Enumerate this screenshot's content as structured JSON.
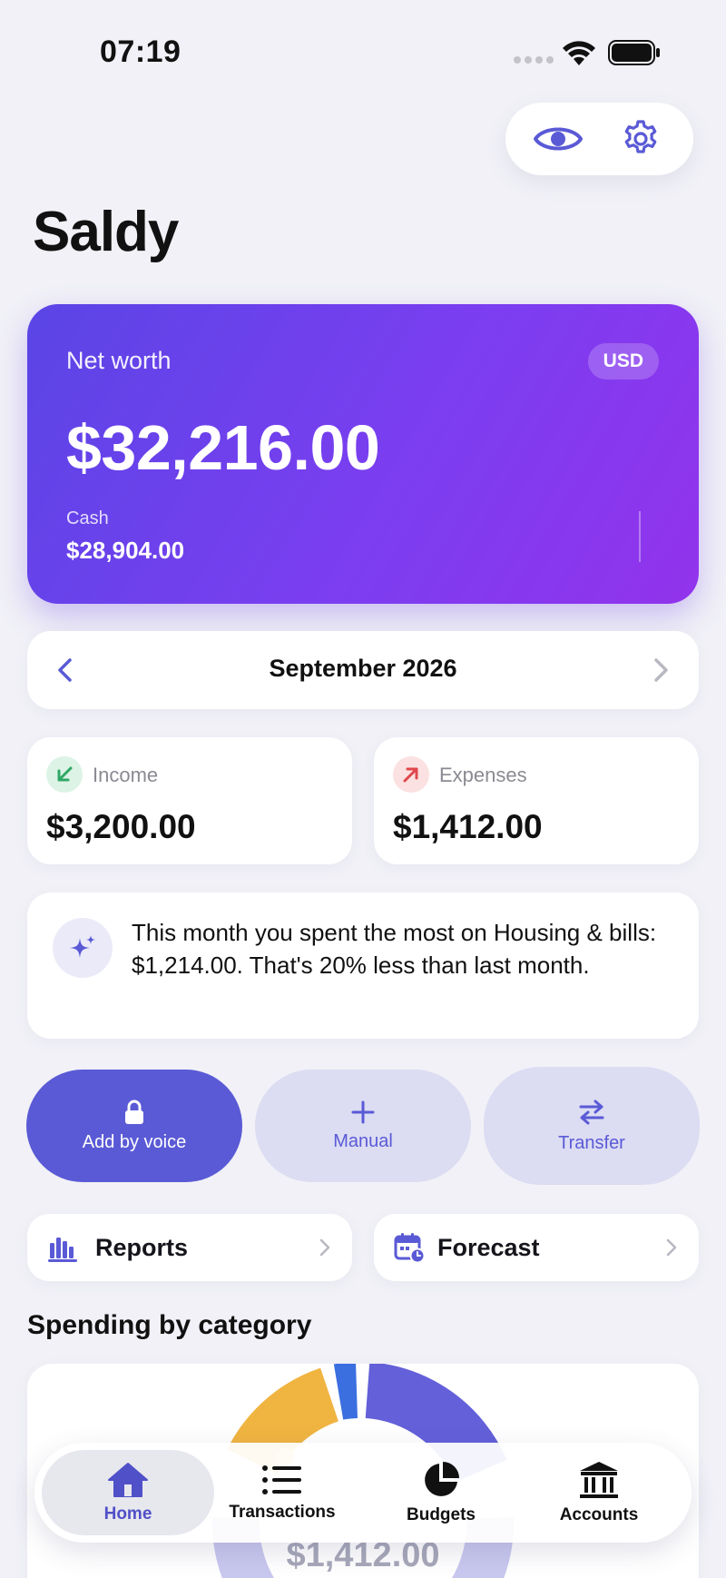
{
  "status_bar": {
    "time": "07:19"
  },
  "header": {
    "app_title": "Saldy"
  },
  "net_worth_card": {
    "label": "Net worth",
    "currency": "USD",
    "value": "$32,216.00",
    "cash_label": "Cash",
    "cash_value": "$28,904.00"
  },
  "month_selector": {
    "month": "September 2026"
  },
  "stats": {
    "income": {
      "label": "Income",
      "value": "$3,200.00"
    },
    "expenses": {
      "label": "Expenses",
      "value": "$1,412.00"
    }
  },
  "insight": {
    "text": "This month you spent the most on Housing & bills: $1,214.00. That's 20% less than last month."
  },
  "actions": {
    "voice_label": "Add by voice",
    "manual_label": "Manual",
    "transfer_label": "Transfer"
  },
  "links": {
    "reports_label": "Reports",
    "forecast_label": "Forecast"
  },
  "spending": {
    "title": "Spending by category",
    "total": "$1,412.00"
  },
  "tabs": [
    {
      "label": "Home",
      "icon": "home-icon",
      "active": true
    },
    {
      "label": "Transactions",
      "icon": "list-icon",
      "active": false
    },
    {
      "label": "Budgets",
      "icon": "pie-chart-icon",
      "active": false
    },
    {
      "label": "Accounts",
      "icon": "bank-icon",
      "active": false
    }
  ],
  "colors": {
    "accent": "#5a5ad6",
    "card_gradient_start": "#5a45e6",
    "card_gradient_end": "#9233ec",
    "income_green": "#2fa866",
    "expense_red": "#e0474c",
    "background": "#f1f1f7"
  }
}
